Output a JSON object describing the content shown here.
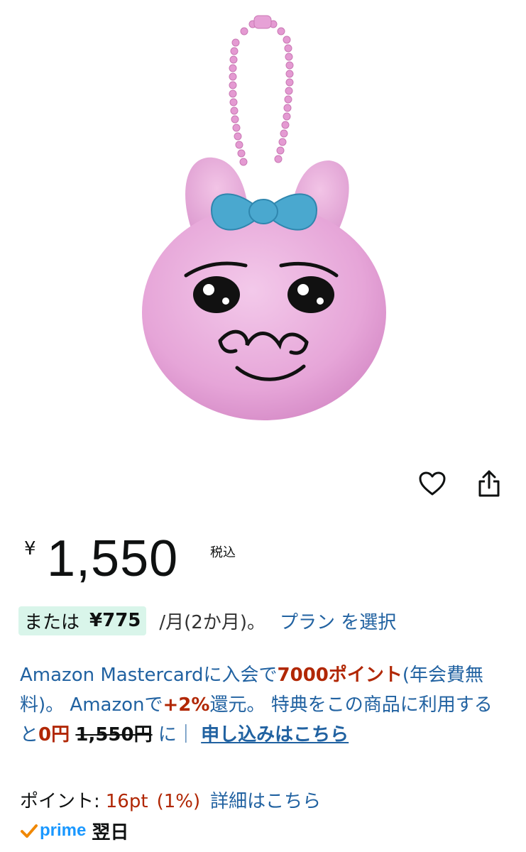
{
  "product": {
    "image_alt": "plush-keychain-pink-rabbit"
  },
  "actions": {
    "favorite_icon": "heart-icon",
    "share_icon": "share-icon"
  },
  "price": {
    "currency": "¥",
    "value": "1,550",
    "tax_label": "税込"
  },
  "installment": {
    "or_label": "または",
    "amount": "¥775",
    "period": "/月(2か月)。",
    "plan_link": "プラン を選択"
  },
  "promo": {
    "part1": "Amazon Mastercardに入会で",
    "points_bonus": "7000ポイント",
    "part2": "(年会費無料)。 Amazonで",
    "return_rate": "+2%",
    "part3": "還元。 特典をこの商品に利用すると",
    "discounted_price": "0円",
    "original_price": "1,550円",
    "part4": "に｜",
    "apply_link": "申し込みはこちら"
  },
  "points": {
    "label": "ポイント:",
    "value": "16pt",
    "percent": "(1%)",
    "detail_link": "詳細はこちら"
  },
  "prime": {
    "brand": "prime",
    "delivery": "翌日"
  },
  "colors": {
    "link": "#2162a1",
    "price_red": "#b12704",
    "installment_bg": "#d9f5ea",
    "prime_blue": "#1a98ff",
    "prime_check": "#f08804"
  }
}
